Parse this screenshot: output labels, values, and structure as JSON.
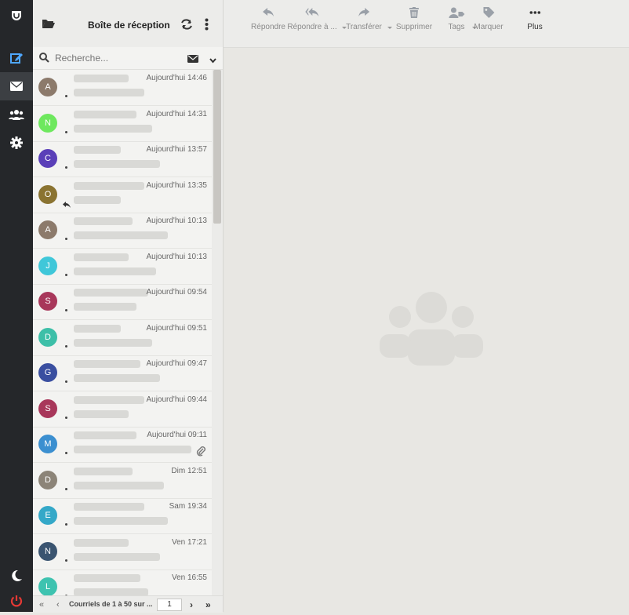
{
  "header": {
    "title": "Boîte de réception"
  },
  "search": {
    "placeholder": "Recherche..."
  },
  "toolbar": [
    {
      "label": "Répondre",
      "icon": "reply-icon",
      "enabled": false,
      "dropdown": false
    },
    {
      "label": "Répondre à ...",
      "icon": "reply-all-icon",
      "enabled": false,
      "dropdown": true
    },
    {
      "label": "Transférer",
      "icon": "forward-icon",
      "enabled": false,
      "dropdown": true
    },
    {
      "label": "Supprimer",
      "icon": "trash-icon",
      "enabled": false,
      "dropdown": false
    },
    {
      "label": "Tags",
      "icon": "tags-icon",
      "enabled": false,
      "dropdown": true
    },
    {
      "label": "Marquer",
      "icon": "tag-icon",
      "enabled": false,
      "dropdown": false
    },
    {
      "label": "Plus",
      "icon": "more-icon",
      "enabled": true,
      "dropdown": false
    }
  ],
  "messages": [
    {
      "initial": "A",
      "color": "#8c7a6b",
      "date": "Aujourd'hui 14:46",
      "replied": false
    },
    {
      "initial": "N",
      "color": "#6ee85e",
      "date": "Aujourd'hui 14:31",
      "replied": false
    },
    {
      "initial": "C",
      "color": "#5a3fb8",
      "date": "Aujourd'hui 13:57",
      "replied": false
    },
    {
      "initial": "O",
      "color": "#8a7331",
      "date": "Aujourd'hui 13:35",
      "replied": true
    },
    {
      "initial": "A",
      "color": "#8c7a6b",
      "date": "Aujourd'hui 10:13",
      "replied": false
    },
    {
      "initial": "J",
      "color": "#3fc7d9",
      "date": "Aujourd'hui 10:13",
      "replied": false
    },
    {
      "initial": "S",
      "color": "#a8375a",
      "date": "Aujourd'hui 09:54",
      "replied": false
    },
    {
      "initial": "D",
      "color": "#3dbfa8",
      "date": "Aujourd'hui 09:51",
      "replied": false
    },
    {
      "initial": "G",
      "color": "#3a4fa0",
      "date": "Aujourd'hui 09:47",
      "replied": false
    },
    {
      "initial": "S",
      "color": "#a8375a",
      "date": "Aujourd'hui 09:44",
      "replied": false
    },
    {
      "initial": "M",
      "color": "#3b8fd0",
      "date": "Aujourd'hui 09:11",
      "replied": false,
      "attachment": true
    },
    {
      "initial": "D",
      "color": "#8c8478",
      "date": "Dim 12:51",
      "replied": false
    },
    {
      "initial": "E",
      "color": "#34a8c8",
      "date": "Sam 19:34",
      "replied": false
    },
    {
      "initial": "N",
      "color": "#3a5470",
      "date": "Ven 17:21",
      "replied": false
    },
    {
      "initial": "L",
      "color": "#3ec3b0",
      "date": "Ven 16:55",
      "replied": false
    }
  ],
  "footer": {
    "count_text": "Courriels de 1 à 50 sur ...",
    "page": "1"
  }
}
